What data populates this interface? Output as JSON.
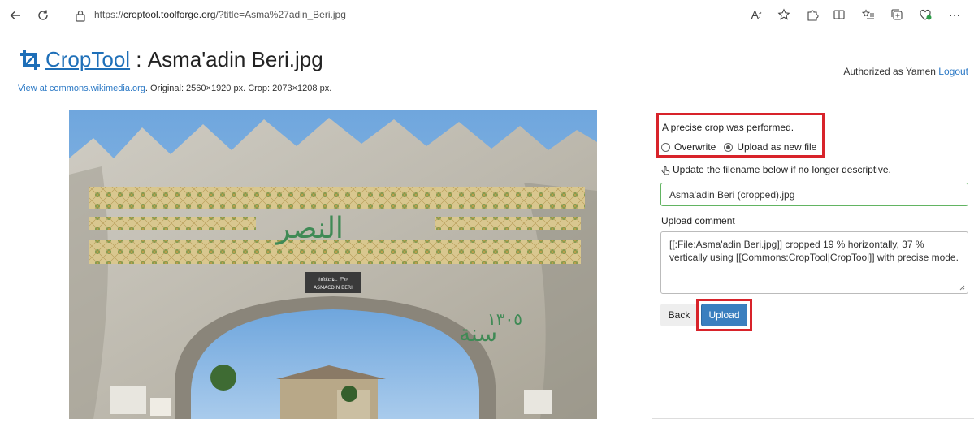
{
  "browser": {
    "url_prefix": "https://",
    "url_host": "croptool.toolforge.org",
    "url_path": "/?title=Asma%27adin_Beri.jpg",
    "read_aloud_label": "A",
    "icons": [
      "back-arrow-icon",
      "refresh-icon",
      "lock-icon",
      "read-aloud-icon",
      "favorite-star-icon",
      "extensions-icon",
      "split-screen-icon",
      "favorites-list-icon",
      "collections-icon",
      "browser-essentials-icon",
      "more-menu-icon"
    ]
  },
  "header": {
    "app_name": "CropTool",
    "title_separator": " : ",
    "file_title": "Asma'adin Beri.jpg",
    "view_link": "View at commons.wikimedia.org",
    "info": ". Original: 2560×1920 px. Crop: 2073×1208 px.",
    "auth_text": "Authorized as Yamen",
    "logout_label": "Logout"
  },
  "form": {
    "precise_message": "A precise crop was performed.",
    "option_overwrite": "Overwrite",
    "option_upload_new": "Upload as new file",
    "selected_option": "Upload as new file",
    "filename_hint": "Update the filename below if no longer descriptive.",
    "filename_value": "Asma'adin Beri (cropped).jpg",
    "comment_label": "Upload comment",
    "comment_value": "[[:File:Asma'adin Beri.jpg]] cropped 19 % horizontally, 37 % vertically using [[Commons:CropTool|CropTool]] with precise mode.",
    "back_label": "Back",
    "upload_label": "Upload"
  },
  "photo": {
    "plaque_line1": "ከበደሮኒር ሞዐ",
    "plaque_line2": "ASMACDIN BERI",
    "arabic_text": "النصر",
    "year_text": "١٣٠٥",
    "arabic_year_word": "سنة"
  },
  "colors": {
    "accent_red": "#d8232a",
    "link_blue": "#2a78c5",
    "upload_blue": "#3a7fbf",
    "valid_green": "#62b462"
  }
}
